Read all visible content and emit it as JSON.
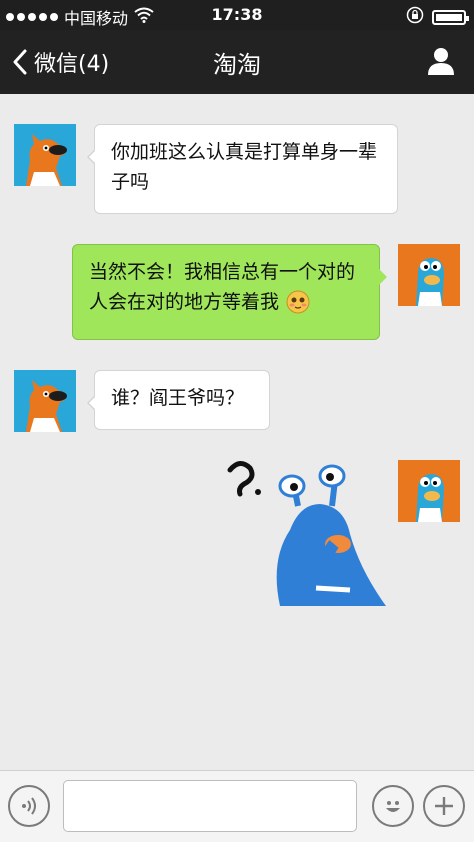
{
  "status_bar": {
    "carrier": "中国移动",
    "time": "17:38",
    "icons": [
      "signal-dots-icon",
      "wifi-icon",
      "rotation-lock-icon",
      "battery-icon"
    ]
  },
  "nav": {
    "back_label": "微信(4)",
    "title": "淘淘",
    "icons": [
      "back-chevron-icon",
      "person-icon"
    ]
  },
  "messages": [
    {
      "side": "in",
      "avatar": "orange-dog-avatar",
      "text": "你加班这么认真是打算单身一辈子吗"
    },
    {
      "side": "out",
      "avatar": "blue-creature-avatar",
      "text": "当然不会！我相信总有一个对的人会在对的地方等着我",
      "emoji": "blushing-emoji-icon"
    },
    {
      "side": "in",
      "avatar": "orange-dog-avatar",
      "text": "谁？阎王爷吗？"
    },
    {
      "side": "out",
      "avatar": "blue-creature-avatar",
      "sticker": "thinking-snail-sticker"
    }
  ],
  "input_bar": {
    "value": "",
    "icons": [
      "voice-icon",
      "smiley-icon",
      "plus-icon"
    ]
  },
  "colors": {
    "status_bar_bg": "#1f1f1f",
    "nav_bg": "#222222",
    "chat_bg": "#ebebeb",
    "outgoing_bubble": "#9fe65a",
    "incoming_bubble": "#ffffff",
    "avatar_in_bg": "#2aa7d9",
    "avatar_out_bg": "#e8771e"
  }
}
